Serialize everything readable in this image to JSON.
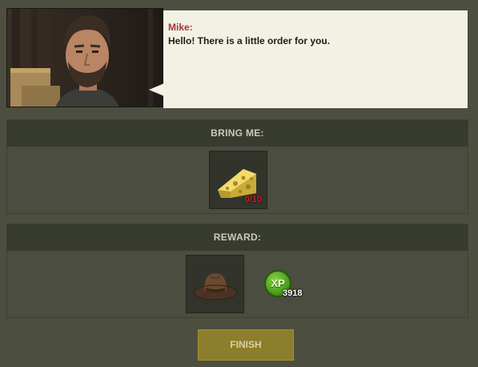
{
  "dialog": {
    "speaker": "Mike:",
    "message": "Hello! There is a little order for you."
  },
  "bring": {
    "header": "BRING ME:",
    "item": {
      "icon": "cheese-icon",
      "count": "0/10"
    }
  },
  "reward": {
    "header": "REWARD:",
    "item": {
      "icon": "cowboy-hat-icon"
    },
    "xp": {
      "badge": "XP",
      "amount": "3918"
    }
  },
  "finish_label": "FINISH",
  "colors": {
    "background": "#4c4f40",
    "header": "#383b2f",
    "bubble": "#f3f1e4",
    "speaker": "#a8333a",
    "count": "#c42323",
    "xp_green": "#4fa21f",
    "button": "#8c7e2a"
  }
}
